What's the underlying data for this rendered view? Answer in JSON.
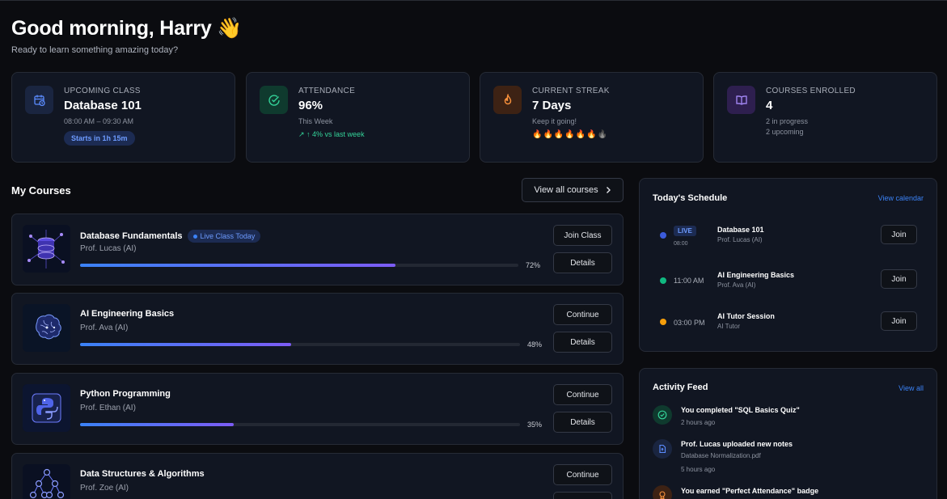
{
  "greeting": {
    "title": "Good morning, Harry",
    "emoji": "👋",
    "subtitle": "Ready to learn something amazing today?"
  },
  "stats": {
    "upcoming": {
      "label": "UPCOMING CLASS",
      "value": "Database 101",
      "sub": "08:00 AM – 09:30 AM",
      "badge": "Starts in 1h 15m",
      "icon": "calendar-clock-icon",
      "color": "#3b82f6"
    },
    "attendance": {
      "label": "ATTENDANCE",
      "value": "96%",
      "sub": "This Week",
      "trend": "↗ ↑ 4% vs last week",
      "icon": "check-circle-icon",
      "color": "#10b981"
    },
    "streak": {
      "label": "CURRENT STREAK",
      "value": "7 Days",
      "sub": "Keep it going!",
      "flames": "🔥🔥🔥🔥🔥🔥",
      "icon": "flame-icon",
      "color": "#f97316"
    },
    "courses": {
      "label": "COURSES ENROLLED",
      "value": "4",
      "sub1": "2 in progress",
      "sub2": "2 upcoming",
      "icon": "open-book-icon",
      "color": "#8b5cf6"
    }
  },
  "my_courses": {
    "title": "My Courses",
    "view_all": "View all courses",
    "items": [
      {
        "name": "Database Fundamentals",
        "live_tag": "Live Class Today",
        "prof": "Prof. Lucas (AI)",
        "progress": 72,
        "pct_label": "72%",
        "btn1": "Join Class",
        "btn2": "Details",
        "thumb": "database-thumbnail"
      },
      {
        "name": "AI Engineering Basics",
        "prof": "Prof. Ava (AI)",
        "progress": 48,
        "pct_label": "48%",
        "btn1": "Continue",
        "btn2": "Details",
        "thumb": "brain-thumbnail"
      },
      {
        "name": "Python Programming",
        "prof": "Prof. Ethan (AI)",
        "progress": 35,
        "pct_label": "35%",
        "btn1": "Continue",
        "btn2": "Details",
        "thumb": "python-thumbnail"
      },
      {
        "name": "Data Structures & Algorithms",
        "prof": "Prof. Zoe (AI)",
        "btn1": "Continue",
        "thumb": "tree-thumbnail"
      }
    ]
  },
  "schedule": {
    "title": "Today's Schedule",
    "link": "View calendar",
    "items": [
      {
        "live": "LIVE",
        "time": "08:00",
        "name": "Database 101",
        "prof": "Prof. Lucas (AI)",
        "btn": "Join",
        "dot_color": "#3b5bdb"
      },
      {
        "time": "11:00 AM",
        "name": "AI Engineering Basics",
        "prof": "Prof. Ava (AI)",
        "btn": "Join",
        "dot_color": "#10b981"
      },
      {
        "time": "03:00 PM",
        "name": "AI Tutor Session",
        "prof": "AI Tutor",
        "btn": "Join",
        "dot_color": "#f59e0b"
      }
    ]
  },
  "activity": {
    "title": "Activity Feed",
    "link": "View all",
    "items": [
      {
        "text": "You completed \"SQL Basics Quiz\"",
        "sub": "2 hours ago",
        "icon": "check-circle-icon"
      },
      {
        "text": "Prof. Lucas uploaded new notes",
        "sub": "Database Normalization.pdf",
        "sub2": "5 hours ago",
        "icon": "file-upload-icon"
      },
      {
        "text": "You earned \"Perfect Attendance\" badge",
        "icon": "medal-icon"
      }
    ]
  }
}
